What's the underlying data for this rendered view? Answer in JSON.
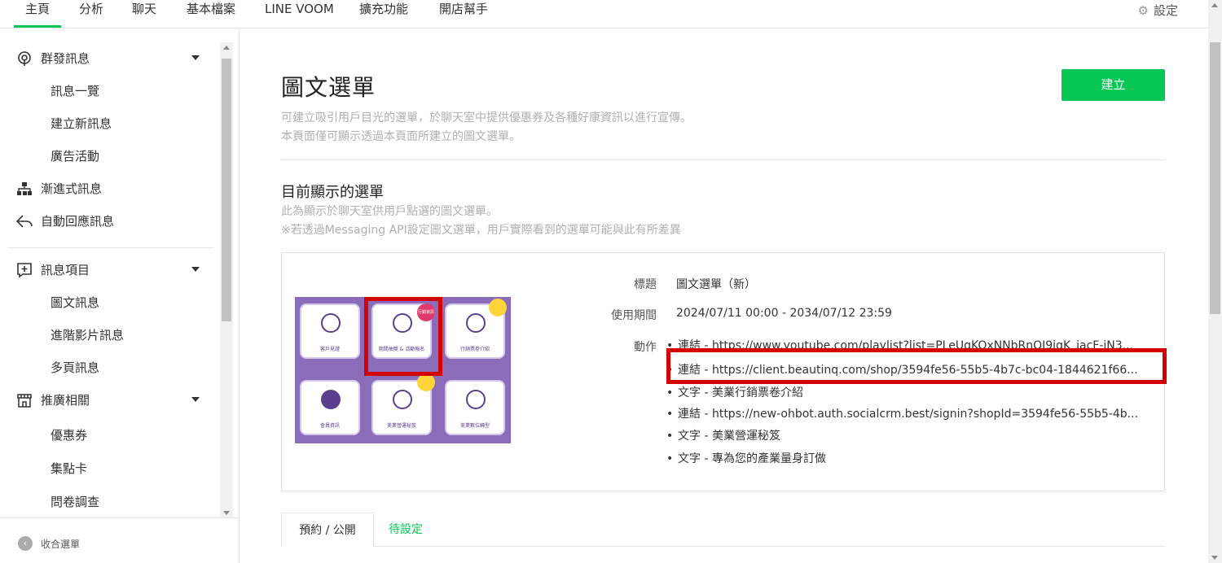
{
  "topnav": {
    "tabs": [
      "主頁",
      "分析",
      "聊天",
      "基本檔案",
      "LINE VOOM",
      "擴充功能",
      "開店幫手"
    ],
    "settings": "設定"
  },
  "sidebar": {
    "groups": [
      {
        "label": "群發訊息",
        "items": [
          "訊息一覽",
          "建立新訊息",
          "廣告活動"
        ]
      },
      {
        "label": "漸進式訊息"
      },
      {
        "label": "自動回應訊息"
      },
      {
        "label": "訊息項目",
        "items": [
          "圖文訊息",
          "進階影片訊息",
          "多頁訊息"
        ]
      },
      {
        "label": "推廣相關",
        "items": [
          "優惠券",
          "集點卡",
          "問卷調查"
        ]
      }
    ],
    "collapse": "收合選單"
  },
  "main": {
    "title": "圖文選單",
    "create_button": "建立",
    "desc1": "可建立吸引用戶目光的選單，於聊天室中提供優惠券及各種好康資訊以進行宣傳。",
    "desc2": "本頁面僅可顯示透過本頁面所建立的圖文選單。",
    "section_title": "目前顯示的選單",
    "section_desc1": "此為顯示於聊天室供用戶點選的圖文選單。",
    "section_desc2": "※若透過Messaging API設定圖文選單，用戶實際看到的選單可能與此有所差異",
    "card": {
      "title_label": "標題",
      "title_value": "圖文選單（新）",
      "period_label": "使用期間",
      "period_value": "2024/07/11 00:00 - 2034/07/12 23:59",
      "action_label": "動作",
      "actions": [
        "連結 - https://www.youtube.com/playlist?list=PLeUqKOxNNbRnQJ9iqK_iacF-iN3...",
        "連結 - https://client.beautinq.com/shop/3594fe56-55b5-4b7c-bc04-1844621f66...",
        "文字 - 美業行銷票卷介紹",
        "連結 - https://new-ohbot.auth.socialcrm.best/signin?shopId=3594fe56-55b5-4b...",
        "文字 - 美業營運秘笈",
        "文字 - 專為您的產業量身訂做"
      ],
      "tiles": [
        "客戶見證",
        "期間抽獎 & 活動報名",
        "行銷票卷介紹",
        "會員資訊",
        "美業營運秘笈",
        "美業數位轉型"
      ],
      "tile_badge": "行銷資訊"
    },
    "tabs": [
      "預約 / 公開",
      "待設定"
    ]
  },
  "colors": {
    "accent": "#06c755",
    "highlight": "#d40000",
    "menu_bg": "#8a6cb8"
  }
}
